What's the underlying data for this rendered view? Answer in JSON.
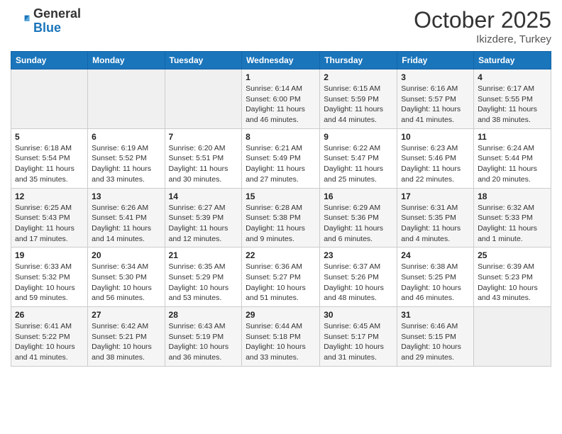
{
  "header": {
    "logo_general": "General",
    "logo_blue": "Blue",
    "month": "October 2025",
    "location": "Ikizdere, Turkey"
  },
  "weekdays": [
    "Sunday",
    "Monday",
    "Tuesday",
    "Wednesday",
    "Thursday",
    "Friday",
    "Saturday"
  ],
  "weeks": [
    [
      {
        "day": "",
        "info": ""
      },
      {
        "day": "",
        "info": ""
      },
      {
        "day": "",
        "info": ""
      },
      {
        "day": "1",
        "info": "Sunrise: 6:14 AM\nSunset: 6:00 PM\nDaylight: 11 hours\nand 46 minutes."
      },
      {
        "day": "2",
        "info": "Sunrise: 6:15 AM\nSunset: 5:59 PM\nDaylight: 11 hours\nand 44 minutes."
      },
      {
        "day": "3",
        "info": "Sunrise: 6:16 AM\nSunset: 5:57 PM\nDaylight: 11 hours\nand 41 minutes."
      },
      {
        "day": "4",
        "info": "Sunrise: 6:17 AM\nSunset: 5:55 PM\nDaylight: 11 hours\nand 38 minutes."
      }
    ],
    [
      {
        "day": "5",
        "info": "Sunrise: 6:18 AM\nSunset: 5:54 PM\nDaylight: 11 hours\nand 35 minutes."
      },
      {
        "day": "6",
        "info": "Sunrise: 6:19 AM\nSunset: 5:52 PM\nDaylight: 11 hours\nand 33 minutes."
      },
      {
        "day": "7",
        "info": "Sunrise: 6:20 AM\nSunset: 5:51 PM\nDaylight: 11 hours\nand 30 minutes."
      },
      {
        "day": "8",
        "info": "Sunrise: 6:21 AM\nSunset: 5:49 PM\nDaylight: 11 hours\nand 27 minutes."
      },
      {
        "day": "9",
        "info": "Sunrise: 6:22 AM\nSunset: 5:47 PM\nDaylight: 11 hours\nand 25 minutes."
      },
      {
        "day": "10",
        "info": "Sunrise: 6:23 AM\nSunset: 5:46 PM\nDaylight: 11 hours\nand 22 minutes."
      },
      {
        "day": "11",
        "info": "Sunrise: 6:24 AM\nSunset: 5:44 PM\nDaylight: 11 hours\nand 20 minutes."
      }
    ],
    [
      {
        "day": "12",
        "info": "Sunrise: 6:25 AM\nSunset: 5:43 PM\nDaylight: 11 hours\nand 17 minutes."
      },
      {
        "day": "13",
        "info": "Sunrise: 6:26 AM\nSunset: 5:41 PM\nDaylight: 11 hours\nand 14 minutes."
      },
      {
        "day": "14",
        "info": "Sunrise: 6:27 AM\nSunset: 5:39 PM\nDaylight: 11 hours\nand 12 minutes."
      },
      {
        "day": "15",
        "info": "Sunrise: 6:28 AM\nSunset: 5:38 PM\nDaylight: 11 hours\nand 9 minutes."
      },
      {
        "day": "16",
        "info": "Sunrise: 6:29 AM\nSunset: 5:36 PM\nDaylight: 11 hours\nand 6 minutes."
      },
      {
        "day": "17",
        "info": "Sunrise: 6:31 AM\nSunset: 5:35 PM\nDaylight: 11 hours\nand 4 minutes."
      },
      {
        "day": "18",
        "info": "Sunrise: 6:32 AM\nSunset: 5:33 PM\nDaylight: 11 hours\nand 1 minute."
      }
    ],
    [
      {
        "day": "19",
        "info": "Sunrise: 6:33 AM\nSunset: 5:32 PM\nDaylight: 10 hours\nand 59 minutes."
      },
      {
        "day": "20",
        "info": "Sunrise: 6:34 AM\nSunset: 5:30 PM\nDaylight: 10 hours\nand 56 minutes."
      },
      {
        "day": "21",
        "info": "Sunrise: 6:35 AM\nSunset: 5:29 PM\nDaylight: 10 hours\nand 53 minutes."
      },
      {
        "day": "22",
        "info": "Sunrise: 6:36 AM\nSunset: 5:27 PM\nDaylight: 10 hours\nand 51 minutes."
      },
      {
        "day": "23",
        "info": "Sunrise: 6:37 AM\nSunset: 5:26 PM\nDaylight: 10 hours\nand 48 minutes."
      },
      {
        "day": "24",
        "info": "Sunrise: 6:38 AM\nSunset: 5:25 PM\nDaylight: 10 hours\nand 46 minutes."
      },
      {
        "day": "25",
        "info": "Sunrise: 6:39 AM\nSunset: 5:23 PM\nDaylight: 10 hours\nand 43 minutes."
      }
    ],
    [
      {
        "day": "26",
        "info": "Sunrise: 6:41 AM\nSunset: 5:22 PM\nDaylight: 10 hours\nand 41 minutes."
      },
      {
        "day": "27",
        "info": "Sunrise: 6:42 AM\nSunset: 5:21 PM\nDaylight: 10 hours\nand 38 minutes."
      },
      {
        "day": "28",
        "info": "Sunrise: 6:43 AM\nSunset: 5:19 PM\nDaylight: 10 hours\nand 36 minutes."
      },
      {
        "day": "29",
        "info": "Sunrise: 6:44 AM\nSunset: 5:18 PM\nDaylight: 10 hours\nand 33 minutes."
      },
      {
        "day": "30",
        "info": "Sunrise: 6:45 AM\nSunset: 5:17 PM\nDaylight: 10 hours\nand 31 minutes."
      },
      {
        "day": "31",
        "info": "Sunrise: 6:46 AM\nSunset: 5:15 PM\nDaylight: 10 hours\nand 29 minutes."
      },
      {
        "day": "",
        "info": ""
      }
    ]
  ]
}
